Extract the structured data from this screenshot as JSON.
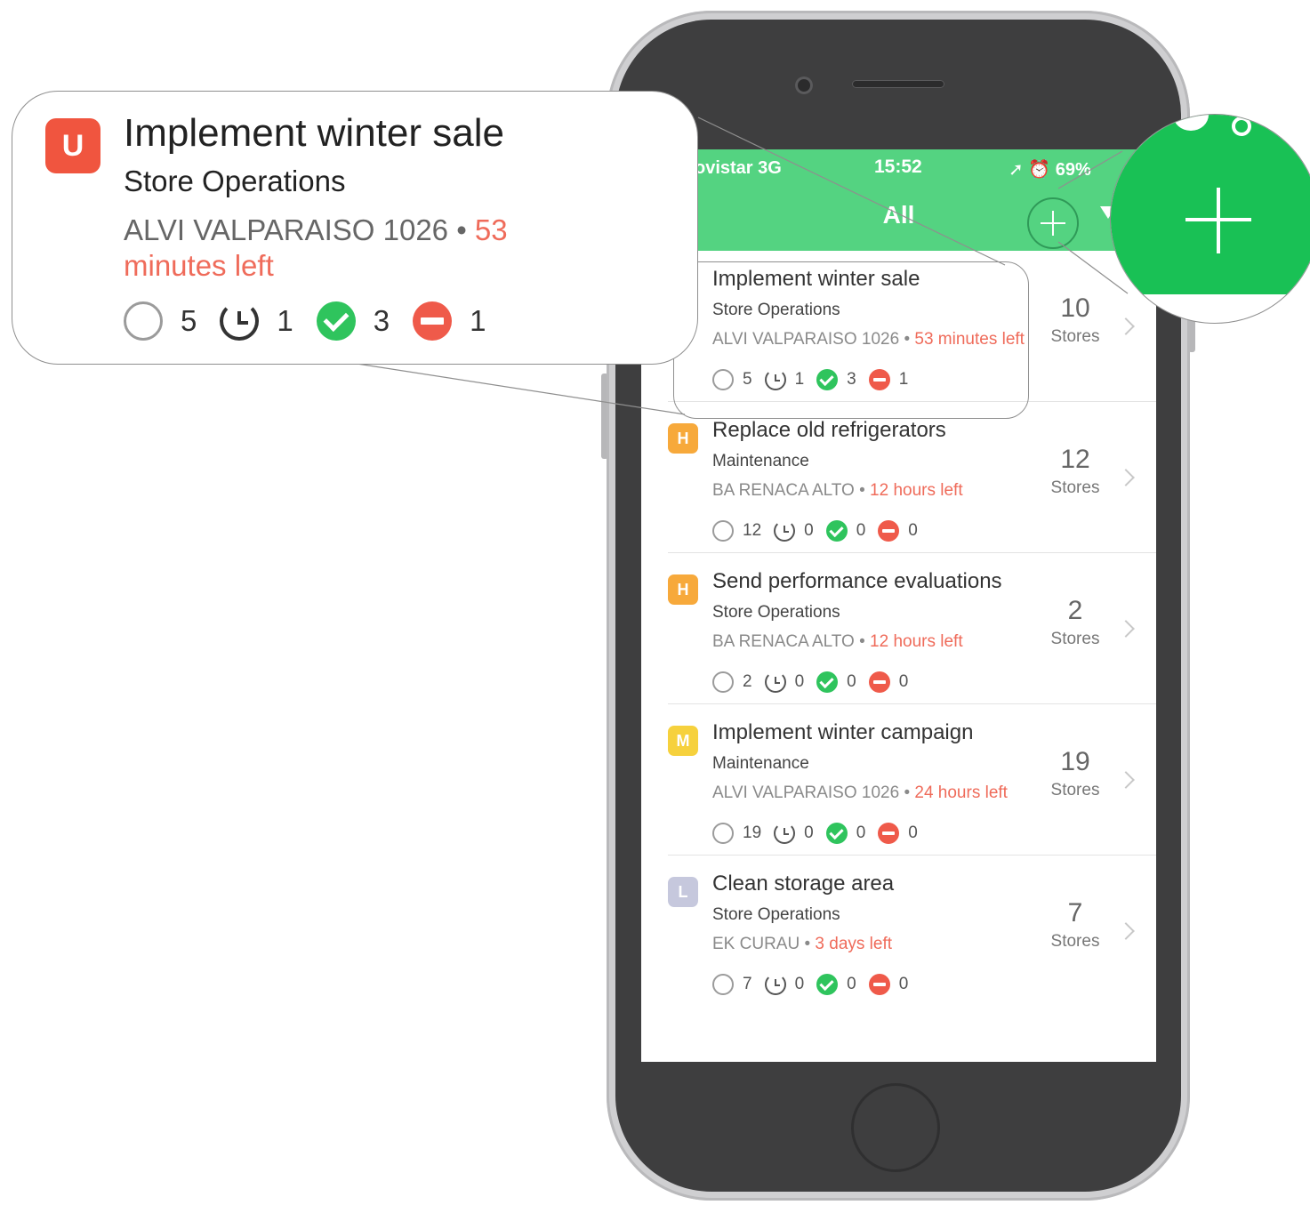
{
  "status_bar": {
    "carrier": "ovistar  3G",
    "time": "15:52",
    "right": "➚ ⏰ 69%"
  },
  "nav": {
    "title": "All"
  },
  "colors": {
    "accent": "#54d381",
    "urgent": "#f0553f",
    "high": "#f7a93b",
    "medium": "#f6d13d",
    "low": "#c6c8dd"
  },
  "tasks": [
    {
      "badge": "U",
      "badge_color": "#f0553f",
      "title": "Implement winter sale",
      "category": "Store Operations",
      "location": "ALVI VALPARAISO 1026 • ",
      "time_left": "53 minutes left",
      "open": "5",
      "in_progress": "1",
      "done": "3",
      "blocked": "1",
      "stores_count": "10",
      "stores_label": "Stores"
    },
    {
      "badge": "H",
      "badge_color": "#f7a93b",
      "title": "Replace old refrigerators",
      "category": "Maintenance",
      "location": "BA RENACA ALTO • ",
      "time_left": "12 hours left",
      "open": "12",
      "in_progress": "0",
      "done": "0",
      "blocked": "0",
      "stores_count": "12",
      "stores_label": "Stores"
    },
    {
      "badge": "H",
      "badge_color": "#f7a93b",
      "title": "Send performance evaluations",
      "category": "Store Operations",
      "location": "BA RENACA ALTO • ",
      "time_left": "12 hours left",
      "open": "2",
      "in_progress": "0",
      "done": "0",
      "blocked": "0",
      "stores_count": "2",
      "stores_label": "Stores"
    },
    {
      "badge": "M",
      "badge_color": "#f6d13d",
      "title": "Implement winter campaign",
      "category": "Maintenance",
      "location": "ALVI VALPARAISO 1026 • ",
      "time_left": "24 hours left",
      "open": "19",
      "in_progress": "0",
      "done": "0",
      "blocked": "0",
      "stores_count": "19",
      "stores_label": "Stores"
    },
    {
      "badge": "L",
      "badge_color": "#c6c8dd",
      "title": "Clean storage area",
      "category": "Store Operations",
      "location": "EK CURAU • ",
      "time_left": "3 days left",
      "open": "7",
      "in_progress": "0",
      "done": "0",
      "blocked": "0",
      "stores_count": "7",
      "stores_label": "Stores"
    }
  ],
  "callout": {
    "badge": "U",
    "title": "Implement winter sale",
    "category": "Store Operations",
    "location": "ALVI VALPARAISO 1026 • ",
    "time_left": "53 minutes left",
    "open": "5",
    "in_progress": "1",
    "done": "3",
    "blocked": "1"
  },
  "icons": {
    "open": "circle-outline-icon",
    "in_progress": "clock-refresh-icon",
    "done": "check-circle-icon",
    "blocked": "minus-circle-icon",
    "add": "plus-icon",
    "filter": "filter-icon",
    "chevron": "chevron-right-icon"
  }
}
